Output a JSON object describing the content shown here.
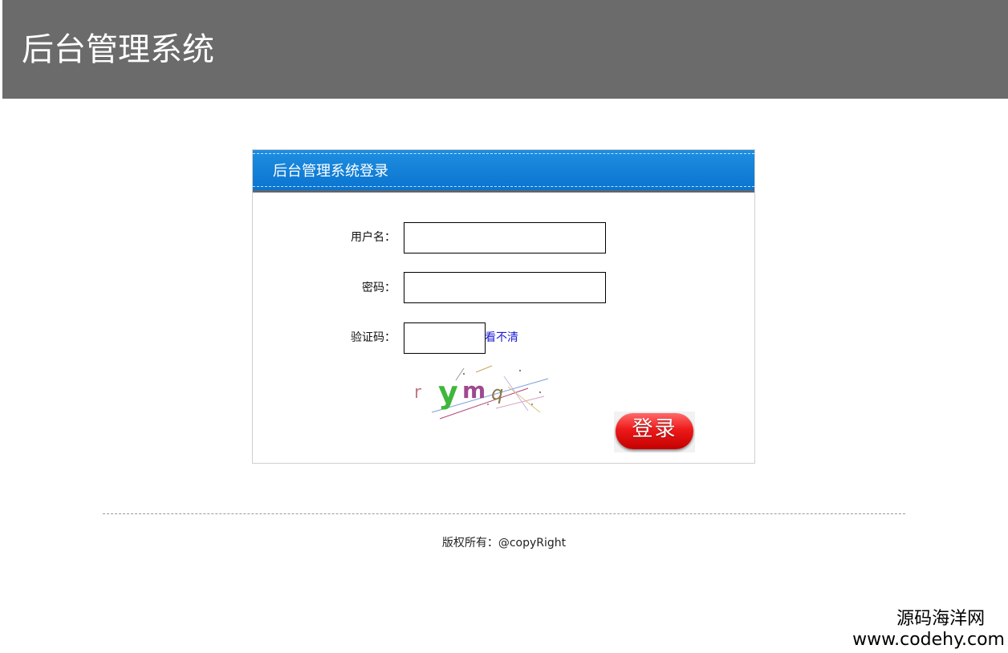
{
  "header": {
    "title": "后台管理系统"
  },
  "login": {
    "title": "后台管理系统登录",
    "username_label": "用户名：",
    "username_value": "",
    "password_label": "密码：",
    "password_value": "",
    "captcha_label": "验证码：",
    "captcha_value": "",
    "captcha_refresh_link": "看不清",
    "captcha_image_text": "r ymq",
    "submit_label": "登录"
  },
  "footer": {
    "copyright": "版权所有：@copyRight"
  },
  "watermark": {
    "name": "源码海洋网",
    "url": "www.codehy.com"
  },
  "colors": {
    "header_bg": "#6b6b6b",
    "login_head_bg": "#1180db",
    "link": "#1a1ad6",
    "button": "#ee1a1a"
  }
}
